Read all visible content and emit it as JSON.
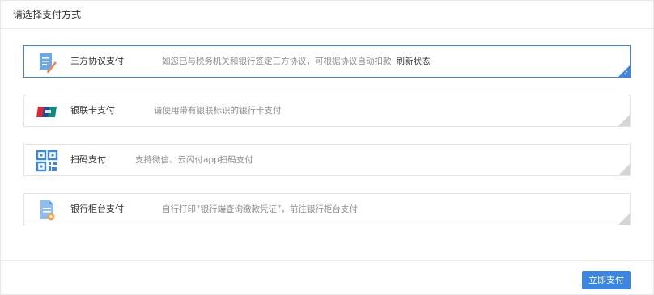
{
  "header": {
    "title": "请选择支付方式"
  },
  "options": [
    {
      "title": "三方协议支付",
      "description": "如您已与税务机关和银行签定三方协议，可根据协议自动扣款",
      "action_link": "刷新状态",
      "icon": "document-edit-icon",
      "selected": true
    },
    {
      "title": "银联卡支付",
      "description": "请使用带有银联标识的银行卡支付",
      "icon": "unionpay-card-icon",
      "selected": false
    },
    {
      "title": "扫码支付",
      "description": "支持微信、云闪付app扫码支付",
      "icon": "qr-code-icon",
      "selected": false
    },
    {
      "title": "银行柜台支付",
      "description": "自行打印“银行端查询缴款凭证”，前往银行柜台支付",
      "icon": "bank-voucher-icon",
      "selected": false
    }
  ],
  "footer": {
    "pay_button": "立即支付"
  },
  "colors": {
    "accent": "#3a86e2",
    "border": "#e3e3e3",
    "muted_text": "#8c8c8c"
  }
}
